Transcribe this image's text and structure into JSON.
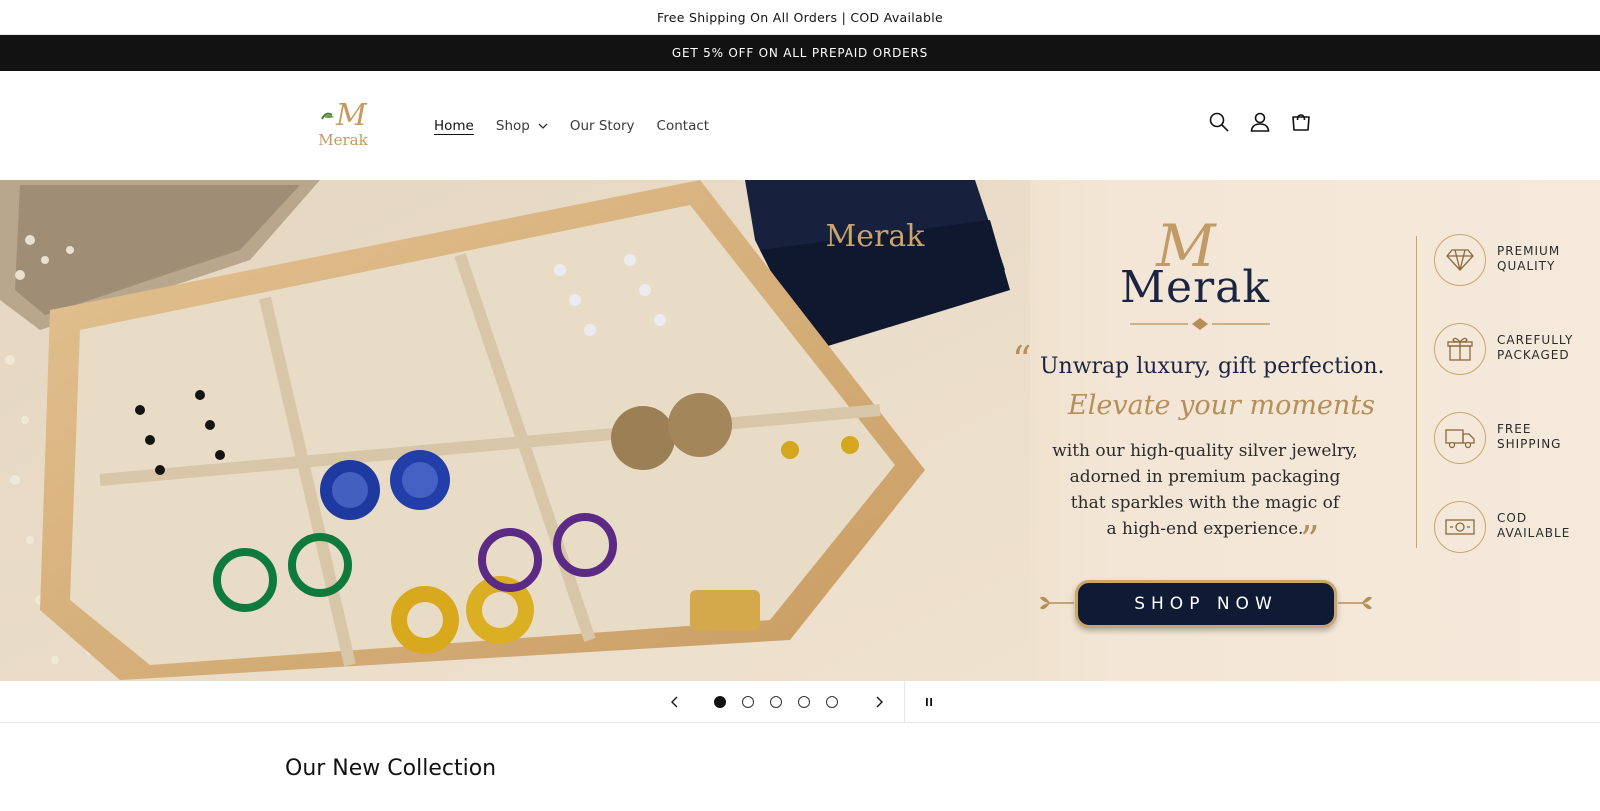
{
  "announcement": {
    "top_text": "Free Shipping On All Orders | COD Available",
    "promo_text": "GET 5% OFF ON ALL PREPAID ORDERS"
  },
  "header": {
    "logo_text": "Merak",
    "nav": [
      {
        "label": "Home",
        "active": true
      },
      {
        "label": "Shop",
        "has_dropdown": true
      },
      {
        "label": "Our Story"
      },
      {
        "label": "Contact"
      }
    ],
    "icons": [
      "search-icon",
      "account-icon",
      "cart-icon"
    ]
  },
  "hero": {
    "brand_monogram": "M",
    "brand_name": "Merak",
    "quote_open": "“",
    "quote_close": "”",
    "headline": "Unwrap luxury, gift perfection.",
    "script_line": "Elevate your moments",
    "body_lines": [
      "with our high-quality silver jewelry,",
      "adorned in premium packaging",
      "that sparkles with the magic of",
      "a high-end experience."
    ],
    "cta_label": "SHOP NOW",
    "box_brand": "Merak",
    "features": [
      {
        "line1": "PREMIUM",
        "line2": "QUALITY",
        "icon": "diamond-icon"
      },
      {
        "line1": "CAREFULLY",
        "line2": "PACKAGED",
        "icon": "gift-icon"
      },
      {
        "line1": "FREE",
        "line2": "SHIPPING",
        "icon": "truck-icon"
      },
      {
        "line1": "COD",
        "line2": "AVAILABLE",
        "icon": "cash-icon"
      }
    ],
    "colors": {
      "navy": "#1b2541",
      "gold": "#b58f59",
      "cta_bg": "#0f1b34"
    }
  },
  "slideshow": {
    "slide_count": 5,
    "active_index": 0
  },
  "collection": {
    "title": "Our New Collection"
  }
}
